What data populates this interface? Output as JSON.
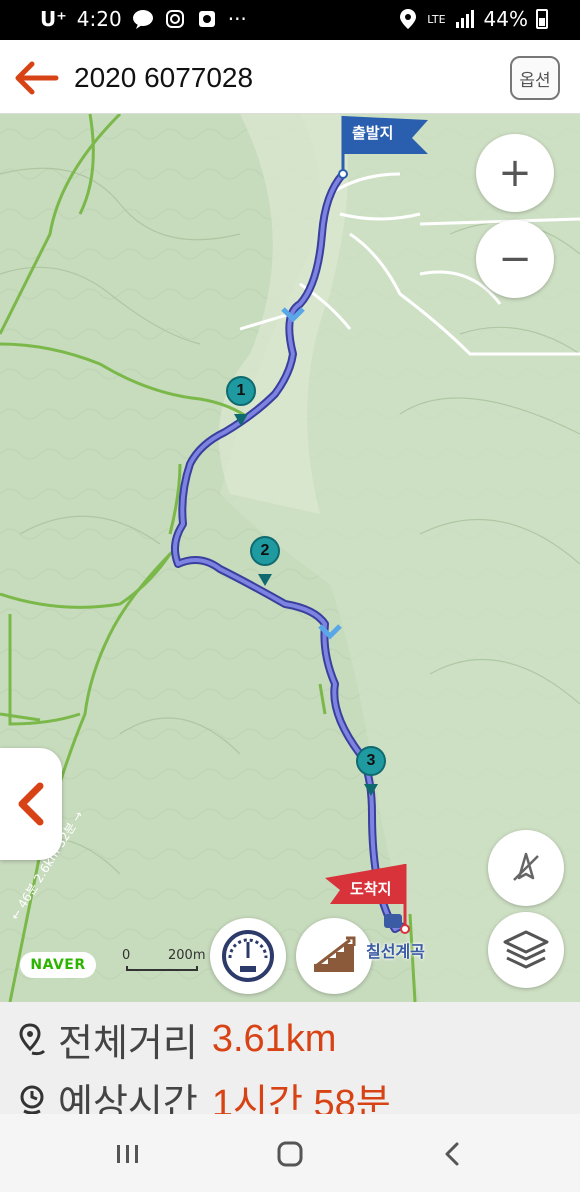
{
  "status_bar": {
    "carrier": "U⁺",
    "time": "4:20",
    "more": "···",
    "network": "LTE",
    "battery": "44%"
  },
  "header": {
    "title": "2020 6077028",
    "options_label": "옵션"
  },
  "map": {
    "start_label": "출발지",
    "end_label": "도착지",
    "waypoints": [
      "1",
      "2",
      "3"
    ],
    "zoom_in": "+",
    "zoom_out": "−",
    "naver_label": "NAVER",
    "scale_zero": "0",
    "scale_distance": "200m",
    "place_name": "칠선계곡",
    "trail_label": "← 46분 2.6km 32분 →"
  },
  "info": {
    "distance_label": "전체거리",
    "distance_value": "3.61km",
    "time_label": "예상시간",
    "time_value": "1시간 58분"
  },
  "colors": {
    "accent": "#d84315",
    "route": "#4a52c8",
    "waypoint": "#1f9aa0",
    "start_flag": "#2a5fb0",
    "end_flag": "#d8323a",
    "trail": "#7bb84a"
  }
}
